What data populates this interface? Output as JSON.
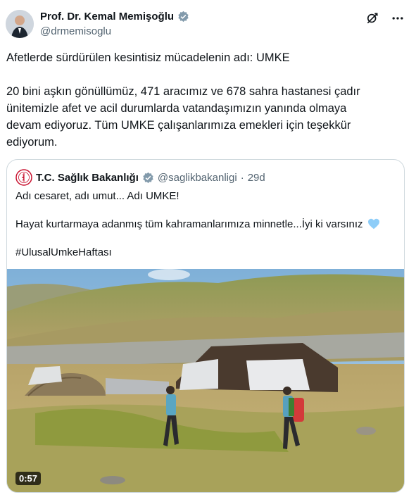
{
  "author": {
    "name": "Prof. Dr. Kemal Memişoğlu",
    "handle": "@drmemisoglu"
  },
  "header_icons": [
    "grok-icon",
    "more-icon"
  ],
  "tweet": {
    "line1": "Afetlerde sürdürülen kesintisiz mücadelenin adı: UMKE",
    "line2": "20 bini aşkın gönüllümüz, 471 aracımız ve 678 sahra hastanesi çadır",
    "line3": "ünitemizle afet ve acil durumlarda vatandaşımızın yanında olmaya",
    "line4": "devam ediyoruz. Tüm UMKE çalışanlarımıza emekleri için teşekkür",
    "line5": "ediyorum."
  },
  "quote": {
    "name": "T.C. Sağlık Bakanlığı",
    "handle": "@saglikbakanligi",
    "separator": "·",
    "time": "29d",
    "line1": "Adı cesaret, adı umut... Adı UMKE!",
    "line2": "Hayat kurtarmaya adanmış tüm kahramanlarımıza minnetle...İyi ki varsınız",
    "hashtag": "#UlusalUmkeHaftası",
    "video_duration": "0:57"
  },
  "colors": {
    "verified": "#829aab",
    "secondary_text": "#536471",
    "border": "#cfd9de",
    "heart": "#8ecdf8",
    "logo_red": "#c8102e"
  }
}
